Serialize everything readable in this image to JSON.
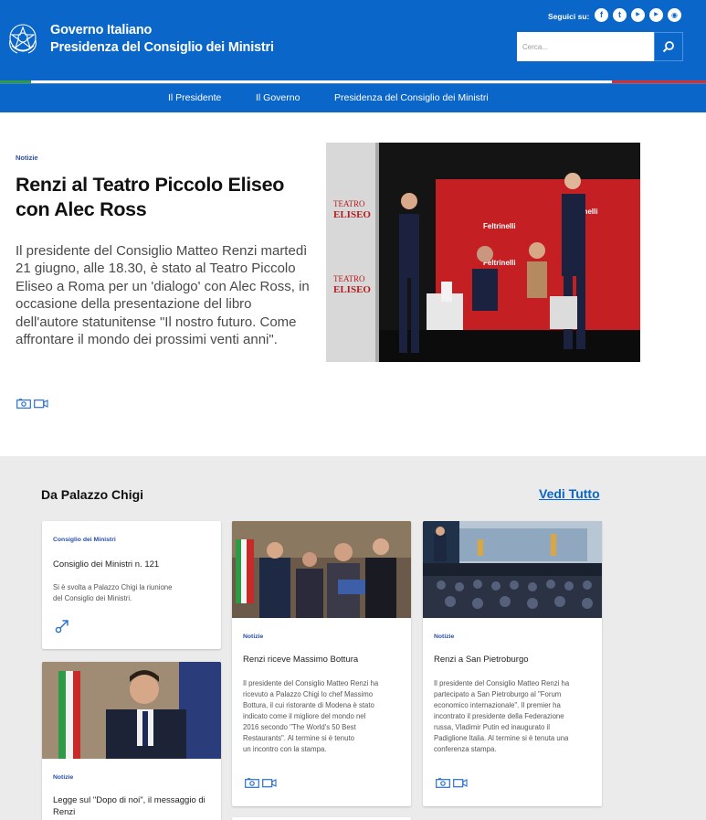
{
  "header": {
    "brand_line1": "Governo Italiano",
    "brand_line2": "Presidenza del Consiglio dei Ministri",
    "follow_label": "Seguici su:",
    "social": [
      {
        "icon": "facebook-icon",
        "glyph": "f"
      },
      {
        "icon": "twitter-icon",
        "glyph": "t"
      },
      {
        "icon": "youtube-icon",
        "glyph": "▶"
      },
      {
        "icon": "youtube-icon",
        "glyph": "▶"
      },
      {
        "icon": "rss-icon",
        "glyph": "◉"
      }
    ],
    "search_placeholder": "Cerca..."
  },
  "nav": {
    "items": [
      "Il Presidente",
      "Il Governo",
      "Presidenza del Consiglio dei Ministri"
    ]
  },
  "hero": {
    "kicker": "Notizie",
    "title": "Renzi al Teatro Piccolo Eliseo con Alec Ross",
    "text": "Il presidente del Consiglio Matteo Renzi martedì 21 giugno, alle 18.30, è stato al Teatro Piccolo Eliseo a Roma per un 'dialogo' con Alec Ross, in occasione della presentazione del libro dell'autore statunitense \"Il nostro futuro. Come affrontare il mondo dei prossimi venti anni\".",
    "photo_backdrop_text": [
      "Feltrinelli",
      "Feltrinelli",
      "Feltrinelli"
    ],
    "photo_side_text": [
      "TEATRO",
      "ELISEO",
      "TEATRO",
      "ELISEO"
    ]
  },
  "section": {
    "title": "Da Palazzo Chigi",
    "see_all": "Vedi Tutto"
  },
  "cards": {
    "c1": {
      "kicker": "Consiglio dei Ministri",
      "title": "Consiglio dei Ministri n. 121",
      "text_lines": [
        "Si è svolta a Palazzo Chigi la riunione",
        "del Consiglio dei Ministri."
      ]
    },
    "c2": {
      "kicker": "Notizie",
      "title": "Renzi riceve Massimo Bottura",
      "text_lines": [
        "Il presidente del Consiglio Matteo Renzi ha",
        "ricevuto a Palazzo Chigi lo chef Massimo",
        "Bottura, il cui ristorante di Modena è stato",
        "indicato come il migliore del mondo nel",
        "2016 secondo \"The World's 50 Best",
        "Restaurants\". Al termine si è tenuto",
        "un incontro con la stampa."
      ]
    },
    "c3": {
      "kicker": "Notizie",
      "title": "Renzi a San Pietroburgo",
      "text_lines": [
        "Il presidente del Consiglio Matteo Renzi ha",
        "partecipato a San Pietroburgo al \"Forum",
        "economico internazionale\". Il premier ha",
        "incontrato il presidente della Federazione",
        "russa, Vladimir Putin ed inaugurato il",
        "Padiglione Italia. Al termine si è tenuta una",
        "conferenza stampa."
      ]
    },
    "c4": {
      "kicker": "Notizie",
      "title_lines": [
        "Legge sul \"Dopo di noi\", il messaggio di",
        "Renzi"
      ]
    }
  }
}
